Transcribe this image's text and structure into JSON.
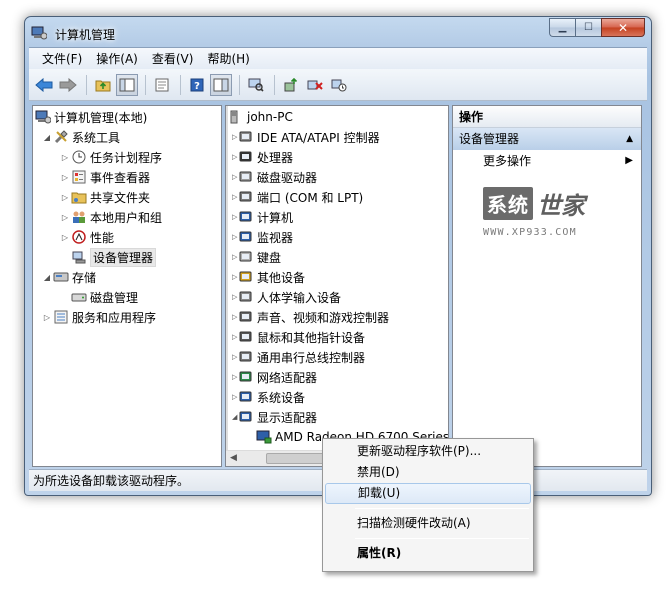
{
  "window": {
    "title": "计算机管理"
  },
  "menu": [
    "文件(F)",
    "操作(A)",
    "查看(V)",
    "帮助(H)"
  ],
  "left_tree": {
    "root": "计算机管理(本地)",
    "system_tools": "系统工具",
    "task_scheduler": "任务计划程序",
    "event_viewer": "事件查看器",
    "shared_folders": "共享文件夹",
    "local_users": "本地用户和组",
    "performance": "性能",
    "device_manager": "设备管理器",
    "storage": "存储",
    "disk_management": "磁盘管理",
    "services_apps": "服务和应用程序"
  },
  "device_tree": {
    "root": "john-PC",
    "items": [
      "IDE ATA/ATAPI 控制器",
      "处理器",
      "磁盘驱动器",
      "端口 (COM 和 LPT)",
      "计算机",
      "监视器",
      "键盘",
      "其他设备",
      "人体学输入设备",
      "声音、视频和游戏控制器",
      "鼠标和其他指针设备",
      "通用串行总线控制器",
      "网络适配器",
      "系统设备",
      "显示适配器"
    ],
    "selected_child": "AMD Radeon HD 6700 Series"
  },
  "actions": {
    "title": "操作",
    "section": "设备管理器",
    "more": "更多操作"
  },
  "watermark": {
    "main": "系统",
    "script": "世家",
    "url": "WWW.XP933.COM"
  },
  "status": {
    "text": "为所选设备卸载该驱动程序。"
  },
  "context_menu": {
    "update": "更新驱动程序软件(P)...",
    "disable": "禁用(D)",
    "uninstall": "卸载(U)",
    "scan": "扫描检测硬件改动(A)",
    "properties": "属性(R)"
  }
}
